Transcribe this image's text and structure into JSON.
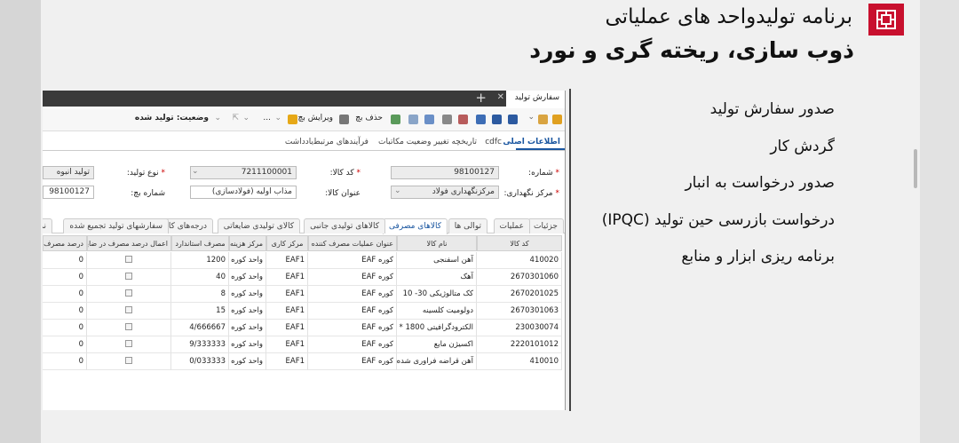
{
  "slide": {
    "title1": "برنامه تولیدواحد های عملیاتی",
    "title2": "ذوب سازی، ریخته گری و نورد",
    "bullets": [
      "صدور سفارش تولید",
      "گردش کار",
      "صدور درخواست به انبار",
      "درخواست بازرسی حین تولید (IPQC)",
      "برنامه ریزی ابزار و منابع"
    ]
  },
  "app": {
    "tab_label": "سفارش تولید",
    "toolbar": {
      "status": "وضعیت: تولید شده",
      "edit": "ویرایش بچ",
      "delete": "حذف بچ",
      "more": "..."
    },
    "form_tabs": [
      "اطلاعات اصلی",
      "cdfc",
      "تاریخچه تغییر وضعیت",
      "مکاتبات",
      "فرآیندهای مرتبط",
      "یادداشت"
    ],
    "fields": {
      "number_label": "شماره:",
      "number_value": "98100127",
      "item_code_label": "کد کالا:",
      "item_code_value": "7211100001",
      "type_label": "نوع تولید:",
      "type_value": "تولید انبوه",
      "center_label": "مرکز نگهداری:",
      "center_value": "مرکزنگهداری فولاد",
      "item_title_label": "عنوان کالا:",
      "item_title_value": "مذاب اولیه (فولادسازی)",
      "batch_label": "شماره بچ:",
      "batch_value": "98100127"
    },
    "sub_tabs": [
      "جزئیات",
      "عملیات",
      "توالی ها",
      "کالاهای مصرفی",
      "کالاهای تولیدی جانبی",
      "کالای تولیدی ضایعاتی",
      "درجه‌های کالا",
      "سفارشهای تولید تجمیع شده",
      "نما"
    ],
    "grid": {
      "columns": [
        "کد کالا",
        "نام کالا",
        "عنوان عملیات مصرف کننده",
        "مرکز کاری",
        "مرکز هزینه",
        "مصرف استاندارد",
        "اعمال درصد مصرف در ضایعا",
        "درصد مصرف د"
      ],
      "rows": [
        [
          "410020",
          "آهن اسفنجی",
          "کوره EAF",
          "EAF1",
          "واحد کوره ذ",
          "1200",
          "",
          "0"
        ],
        [
          "2670301060",
          "آهک",
          "کوره EAF",
          "EAF1",
          "واحد کوره ذ",
          "40",
          "",
          "0"
        ],
        [
          "2670201025",
          "کک متالوژیکی 30- 10",
          "کوره EAF",
          "EAF1",
          "واحد کوره ذ",
          "8",
          "",
          "0"
        ],
        [
          "2670301063",
          "دولومیت کلسینه",
          "کوره EAF",
          "EAF1",
          "واحد کوره ذ",
          "15",
          "",
          "0"
        ],
        [
          "230030074",
          "الکترودگرافیتی 1800 * 400",
          "کوره EAF",
          "EAF1",
          "واحد کوره ذ",
          "4/666667",
          "",
          "0"
        ],
        [
          "2220101012",
          "اکسیژن مایع",
          "کوره EAF",
          "EAF1",
          "واحد کوره ذ",
          "9/333333",
          "",
          "0"
        ],
        [
          "410010",
          "آهن قراضه فراوری شده",
          "کوره EAF",
          "EAF1",
          "واحد کوره ذ",
          "0/033333",
          "",
          "0"
        ]
      ]
    }
  },
  "colors": {
    "logo": "#c8102e",
    "accent": "#1a56a0",
    "tabbar": "#3a3a3a"
  }
}
